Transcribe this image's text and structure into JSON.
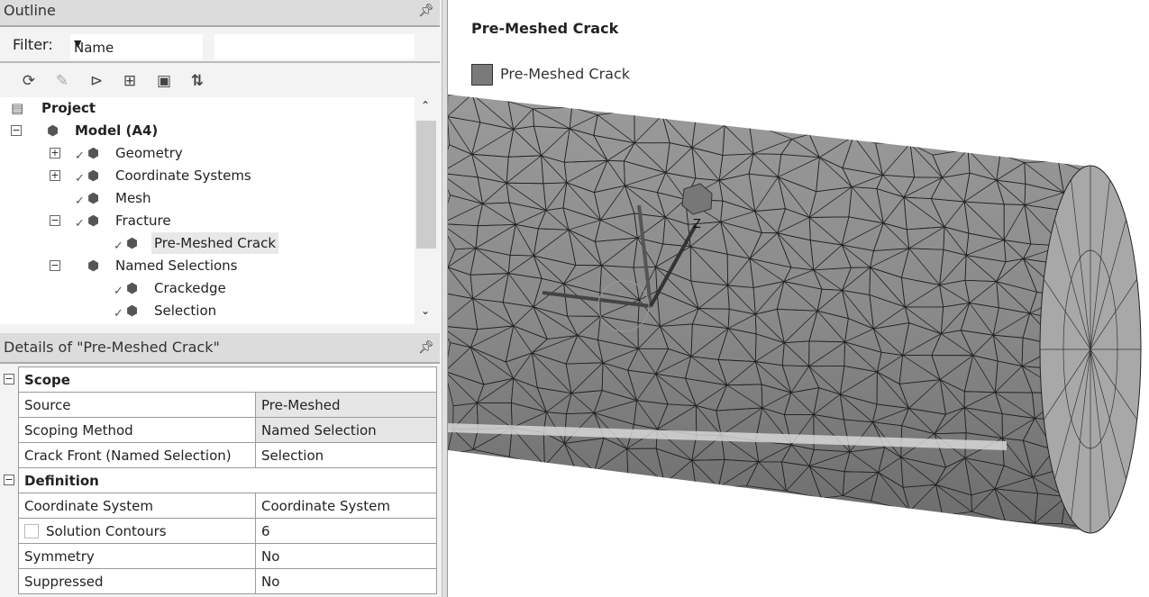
{
  "outline": {
    "title": "Outline",
    "filter_label": "Filter:",
    "filter_value": "Name",
    "filter_text": "",
    "toolbar": [
      {
        "icon": "refresh-icon"
      },
      {
        "icon": "edit-icon"
      },
      {
        "icon": "connection-icon"
      },
      {
        "icon": "expand-all-icon"
      },
      {
        "icon": "folder-icon"
      },
      {
        "icon": "sort-az-icon"
      }
    ],
    "tree": [
      {
        "label": "Project",
        "level": 0,
        "bold": true,
        "expander": ""
      },
      {
        "label": "Model (A4)",
        "level": 1,
        "bold": true,
        "expander": "-"
      },
      {
        "label": "Geometry",
        "level": 2,
        "expander": "+",
        "check": true
      },
      {
        "label": "Coordinate Systems",
        "level": 2,
        "expander": "+",
        "check": true
      },
      {
        "label": "Mesh",
        "level": 2,
        "expander": "",
        "check": true
      },
      {
        "label": "Fracture",
        "level": 2,
        "expander": "-",
        "check": true
      },
      {
        "label": "Pre-Meshed Crack",
        "level": 3,
        "expander": "",
        "check": true,
        "selected": true
      },
      {
        "label": "Named Selections",
        "level": 2,
        "expander": "-",
        "check": false
      },
      {
        "label": "Crackedge",
        "level": 3,
        "expander": "",
        "check": true
      },
      {
        "label": "Selection",
        "level": 3,
        "expander": "",
        "check": true
      }
    ]
  },
  "details": {
    "title": "Details of \"Pre-Meshed Crack\"",
    "groups": [
      {
        "name": "Scope",
        "rows": [
          [
            "Source",
            "Pre-Meshed"
          ],
          [
            "Scoping Method",
            "Named Selection"
          ],
          [
            "Crack Front (Named Selection)",
            "Selection"
          ]
        ]
      },
      {
        "name": "Definition",
        "rows": [
          [
            "Coordinate System",
            "Coordinate System"
          ],
          [
            "Solution Contours",
            "6"
          ],
          [
            "Symmetry",
            "No"
          ],
          [
            "Suppressed",
            "No"
          ]
        ]
      }
    ]
  },
  "viewport": {
    "title": "Pre-Meshed Crack",
    "legend": "Pre-Meshed Crack",
    "legend_color": "#7a7a7a",
    "body_color": "#8c8c8c",
    "axis_label": "Z"
  }
}
